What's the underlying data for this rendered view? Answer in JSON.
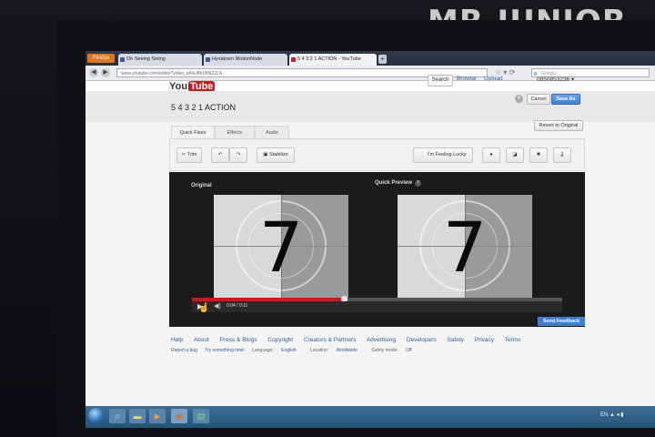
{
  "watermark": "MR.JUNIOR",
  "browser": {
    "firefox_button": "Firefox",
    "tabs": [
      {
        "label": "On Seeing Seiing"
      },
      {
        "label": "Hyvaksen MotionNode"
      },
      {
        "label": "5 4 3 2 1 ACTION - YouTube"
      }
    ],
    "new_tab": "+",
    "url": "www.youtube.com/editor?video_id=kJ8h1BNZ2LA",
    "search_placeholder": "Google",
    "search_engine_icon": "g"
  },
  "youtube": {
    "logo_you": "You",
    "logo_tube": "Tube",
    "search_button": "Search",
    "nav": {
      "browse": "Browse",
      "upload": "Upload"
    },
    "user": "0850853236 ▾"
  },
  "editor": {
    "video_title": "5 4 3 2 1 ACTION",
    "cancel": "Cancel",
    "save_as": "Save As",
    "revert": "Revert to Original",
    "tabs": [
      {
        "label": "Quick Fixes"
      },
      {
        "label": "Effects"
      },
      {
        "label": "Audio"
      }
    ],
    "tools": {
      "trim": "Trim",
      "stabilize": "Stabilize",
      "feeling_lucky": "I'm Feeling Lucky"
    },
    "original_label": "Original",
    "preview_label": "Quick Preview",
    "countdown_number": "7",
    "progress_fraction": 0.41,
    "time": "0:04 / 0:11",
    "send_feedback": "Send Feedback"
  },
  "footer": {
    "links": [
      "Help",
      "About",
      "Press & Blogs",
      "Copyright",
      "Creators & Partners",
      "Advertising",
      "Developers",
      "Safety",
      "Privacy",
      "Terms"
    ],
    "report_bug": "Report a bug",
    "try_new": "Try something new!",
    "language_label": "Language:",
    "language": "English",
    "location_label": "Location:",
    "location": "Worldwide",
    "safety_label": "Safety mode:",
    "safety": "Off"
  },
  "taskbar": {
    "tray": "EN ▲ ◂ ▮"
  },
  "colors": {
    "youtube_red": "#cc181e",
    "link_blue": "#2d5fa8",
    "button_blue": "#3d7fd7"
  }
}
